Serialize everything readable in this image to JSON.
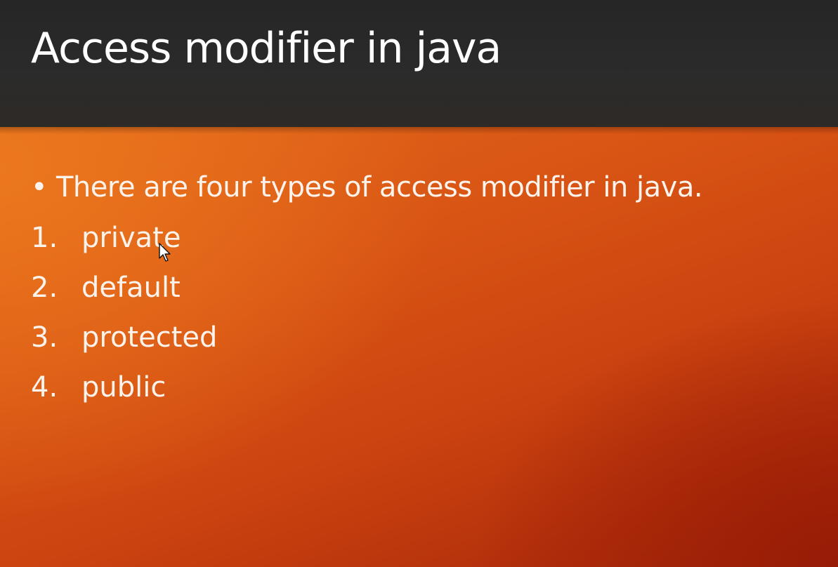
{
  "slide": {
    "title": "Access modifier in java",
    "bullet": {
      "marker": "•",
      "text": "There are four types of access modifier in java."
    },
    "items": [
      {
        "number": "1.",
        "label": "private"
      },
      {
        "number": "2.",
        "label": "default"
      },
      {
        "number": "3.",
        "label": "protected"
      },
      {
        "number": "4.",
        "label": "public"
      }
    ]
  },
  "colors": {
    "title_band": "#262626",
    "background_orange": "#d85414",
    "background_dark_red": "#a52a0a",
    "text": "#fbf3ec"
  },
  "icons": {
    "cursor": "mouse-pointer-icon"
  }
}
